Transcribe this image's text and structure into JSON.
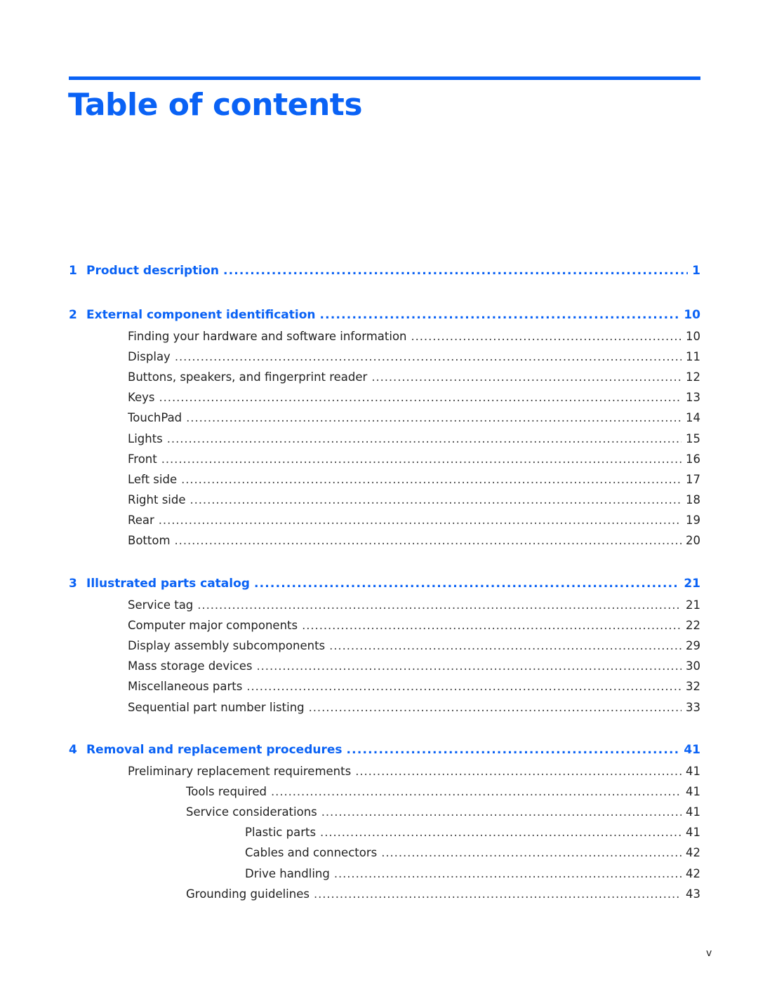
{
  "title": "Table of contents",
  "accent_color": "#0a62f5",
  "chapters": [
    {
      "number": "1",
      "label": "Product description",
      "page": "1",
      "entries": []
    },
    {
      "number": "2",
      "label": "External component identification",
      "page": "10",
      "entries": [
        {
          "label": "Finding your hardware and software information",
          "page": "10",
          "level": 1
        },
        {
          "label": "Display",
          "page": "11",
          "level": 1
        },
        {
          "label": "Buttons, speakers, and fingerprint reader",
          "page": "12",
          "level": 1
        },
        {
          "label": "Keys",
          "page": "13",
          "level": 1
        },
        {
          "label": "TouchPad",
          "page": "14",
          "level": 1
        },
        {
          "label": "Lights",
          "page": "15",
          "level": 1
        },
        {
          "label": "Front",
          "page": "16",
          "level": 1
        },
        {
          "label": "Left side",
          "page": "17",
          "level": 1
        },
        {
          "label": "Right side",
          "page": "18",
          "level": 1
        },
        {
          "label": "Rear",
          "page": "19",
          "level": 1
        },
        {
          "label": "Bottom",
          "page": "20",
          "level": 1
        }
      ]
    },
    {
      "number": "3",
      "label": "Illustrated parts catalog",
      "page": "21",
      "entries": [
        {
          "label": "Service tag",
          "page": "21",
          "level": 1
        },
        {
          "label": "Computer major components",
          "page": "22",
          "level": 1
        },
        {
          "label": "Display assembly subcomponents",
          "page": "29",
          "level": 1
        },
        {
          "label": "Mass storage devices",
          "page": "30",
          "level": 1
        },
        {
          "label": "Miscellaneous parts",
          "page": "32",
          "level": 1
        },
        {
          "label": "Sequential part number listing",
          "page": "33",
          "level": 1
        }
      ]
    },
    {
      "number": "4",
      "label": "Removal and replacement procedures",
      "page": "41",
      "entries": [
        {
          "label": "Preliminary replacement requirements",
          "page": "41",
          "level": 1
        },
        {
          "label": "Tools required",
          "page": "41",
          "level": 2
        },
        {
          "label": "Service considerations",
          "page": "41",
          "level": 2
        },
        {
          "label": "Plastic parts",
          "page": "41",
          "level": 3
        },
        {
          "label": "Cables and connectors",
          "page": "42",
          "level": 3
        },
        {
          "label": "Drive handling",
          "page": "42",
          "level": 3
        },
        {
          "label": "Grounding guidelines",
          "page": "43",
          "level": 2
        }
      ]
    }
  ],
  "footer": {
    "page_number": "v"
  }
}
